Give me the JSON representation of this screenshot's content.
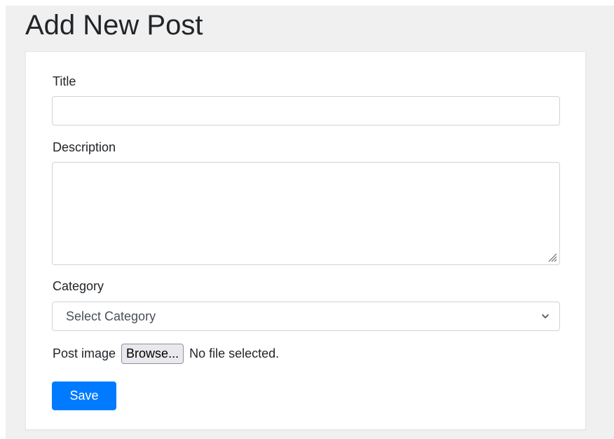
{
  "page": {
    "title": "Add New Post"
  },
  "form": {
    "title_label": "Title",
    "title_value": "",
    "description_label": "Description",
    "description_value": "",
    "category_label": "Category",
    "category_selected": "Select Category",
    "image_label": "Post image",
    "browse_label": "Browse...",
    "file_status": "No file selected.",
    "save_label": "Save"
  },
  "icons": {
    "select_chevron": "chevron-down-icon",
    "resize_grip": "resize-grip-icon"
  },
  "colors": {
    "primary": "#007bff",
    "page_background": "#f0f0f0",
    "card_background": "#ffffff",
    "input_border": "#ced4da"
  }
}
